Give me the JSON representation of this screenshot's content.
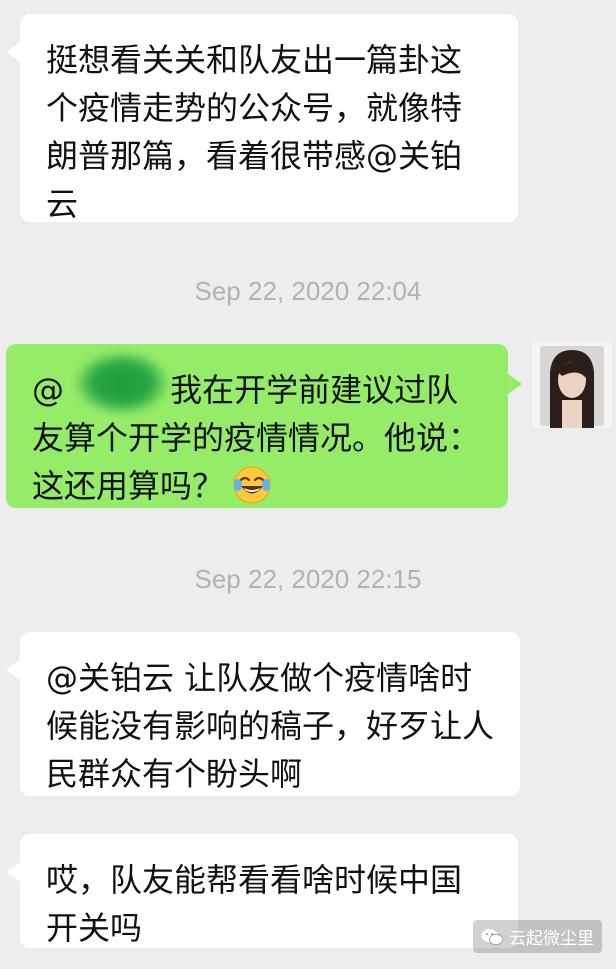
{
  "messages": [
    {
      "side": "left",
      "text": "挺想看关关和队友出一篇卦这个疫情走势的公众号，就像特朗普那篇，看着很带感@关铂云"
    },
    {
      "side": "right",
      "mention_prefix": "@",
      "text": "我在开学前建议过队友算个开学的疫情情况。他说：这还用算吗？",
      "emoji": "face-with-tears-of-joy-icon"
    },
    {
      "side": "left",
      "text": "@关铂云 让队友做个疫情啥时候能没有影响的稿子，好歹让人民群众有个盼头啊"
    },
    {
      "side": "left",
      "text": "哎，队友能帮看看啥时候中国开关吗"
    }
  ],
  "timestamps": [
    "Sep 22, 2020 22:04",
    "Sep 22, 2020 22:15"
  ],
  "watermark": {
    "text": "云起微尘里",
    "icon": "wechat-icon"
  },
  "colors": {
    "background": "#ededed",
    "bubble_left": "#ffffff",
    "bubble_right": "#95ec69",
    "timestamp": "#b2b2b2"
  }
}
